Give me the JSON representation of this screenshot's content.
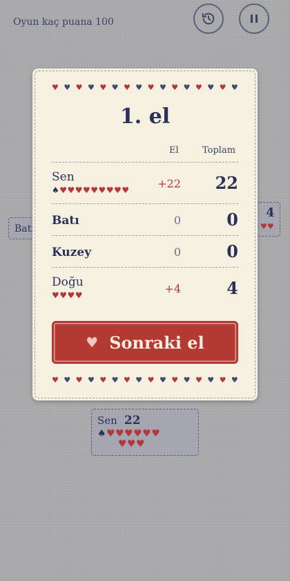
{
  "topbar": {
    "title": "Oyun kaç puana 100"
  },
  "players_bg": {
    "west": {
      "label": "Batı"
    },
    "east": {
      "score": "4",
      "hearts": "♥♥"
    },
    "south": {
      "name": "Sen",
      "score": "22",
      "suit": "♠",
      "hearts_line1": "♥♥♥♥♥♥",
      "hearts_line2": "♥♥♥"
    }
  },
  "modal": {
    "title": "1. el",
    "headers": {
      "round": "El",
      "total": "Toplam"
    },
    "rows": [
      {
        "name": "Sen",
        "delta": "+22",
        "total": "22",
        "suit": "♠",
        "hearts": "♥♥♥♥♥♥♥♥♥"
      },
      {
        "name": "Batı",
        "delta": "0",
        "total": "0"
      },
      {
        "name": "Kuzey",
        "delta": "0",
        "total": "0"
      },
      {
        "name": "Doğu",
        "delta": "+4",
        "total": "4",
        "hearts": "♥♥♥♥"
      }
    ],
    "next_button": {
      "label": "Sonraki el",
      "icon": "heart-icon"
    }
  },
  "colors": {
    "accent_red": "#b33a33",
    "navy": "#2c3257",
    "card_bg": "#f6f0e1",
    "table_bg": "#a7a7a9"
  }
}
